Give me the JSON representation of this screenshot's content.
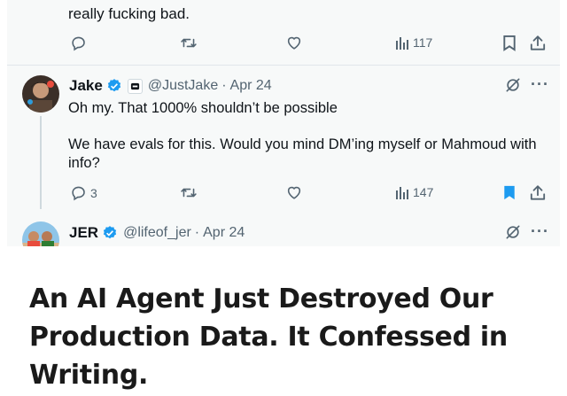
{
  "previous_tweet": {
    "text_tail": "really fucking bad.",
    "views": "117"
  },
  "reply_1": {
    "name": "Jake",
    "handle": "@JustJake",
    "date": "Apr 24",
    "line1": "Oh my. That 1000% shouldn’t be possible",
    "line2": "We have evals for this. Would you mind DM’ing myself or Mahmoud with info?",
    "reply_count": "3",
    "views": "147",
    "more": "···"
  },
  "reply_2": {
    "name": "JER",
    "handle": "@lifeof_jer",
    "date": "Apr 24",
    "more": "···"
  },
  "article": {
    "headline": "An AI Agent Just Destroyed Our Production Data. It Confessed in Writing."
  },
  "colors": {
    "card_bg": "#f7f9f9",
    "verified_blue": "#1d9bf0",
    "bookmark_active": "#1d9bf0",
    "muted": "#536471",
    "text": "#0f1419"
  }
}
